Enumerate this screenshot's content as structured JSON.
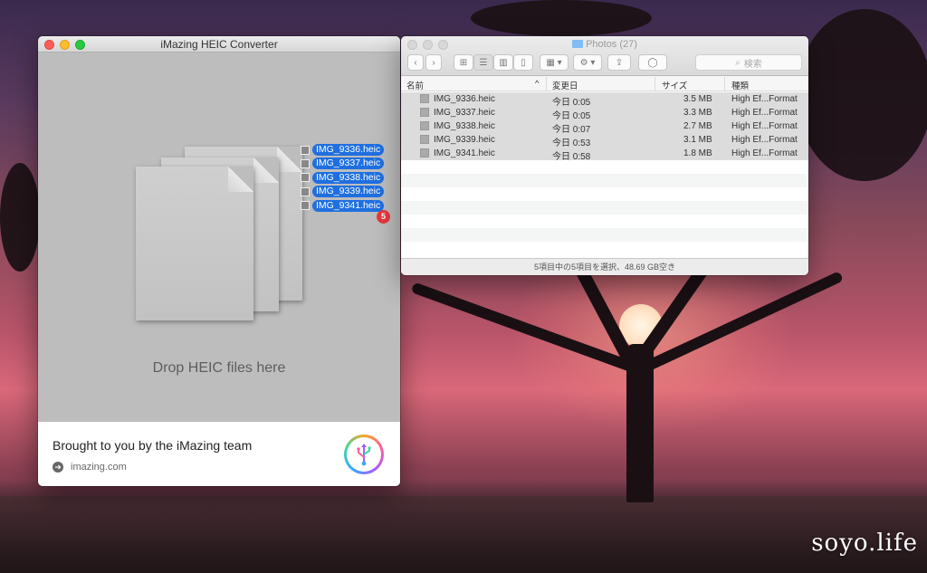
{
  "imazing": {
    "title": "iMazing HEIC Converter",
    "drop_text": "Drop HEIC files here",
    "credit": "Brought to you by the iMazing team",
    "site": "imazing.com",
    "drag_files": [
      "IMG_9336.heic",
      "IMG_9337.heic",
      "IMG_9338.heic",
      "IMG_9339.heic",
      "IMG_9341.heic"
    ],
    "drag_count": "5"
  },
  "finder": {
    "title": "Photos (27)",
    "search_placeholder": "検索",
    "columns": {
      "name": "名前",
      "modified": "変更日",
      "size": "サイズ",
      "kind": "種類"
    },
    "files": [
      {
        "name": "IMG_9336.heic",
        "modified": "今日 0:05",
        "size": "3.5 MB",
        "kind": "High Ef...Format"
      },
      {
        "name": "IMG_9337.heic",
        "modified": "今日 0:05",
        "size": "3.3 MB",
        "kind": "High Ef...Format"
      },
      {
        "name": "IMG_9338.heic",
        "modified": "今日 0:07",
        "size": "2.7 MB",
        "kind": "High Ef...Format"
      },
      {
        "name": "IMG_9339.heic",
        "modified": "今日 0:53",
        "size": "3.1 MB",
        "kind": "High Ef...Format"
      },
      {
        "name": "IMG_9341.heic",
        "modified": "今日 0:58",
        "size": "1.8 MB",
        "kind": "High Ef...Format"
      }
    ],
    "status": "5項目中の5項目を選択、48.69 GB空き"
  },
  "watermark": "soyo.life"
}
